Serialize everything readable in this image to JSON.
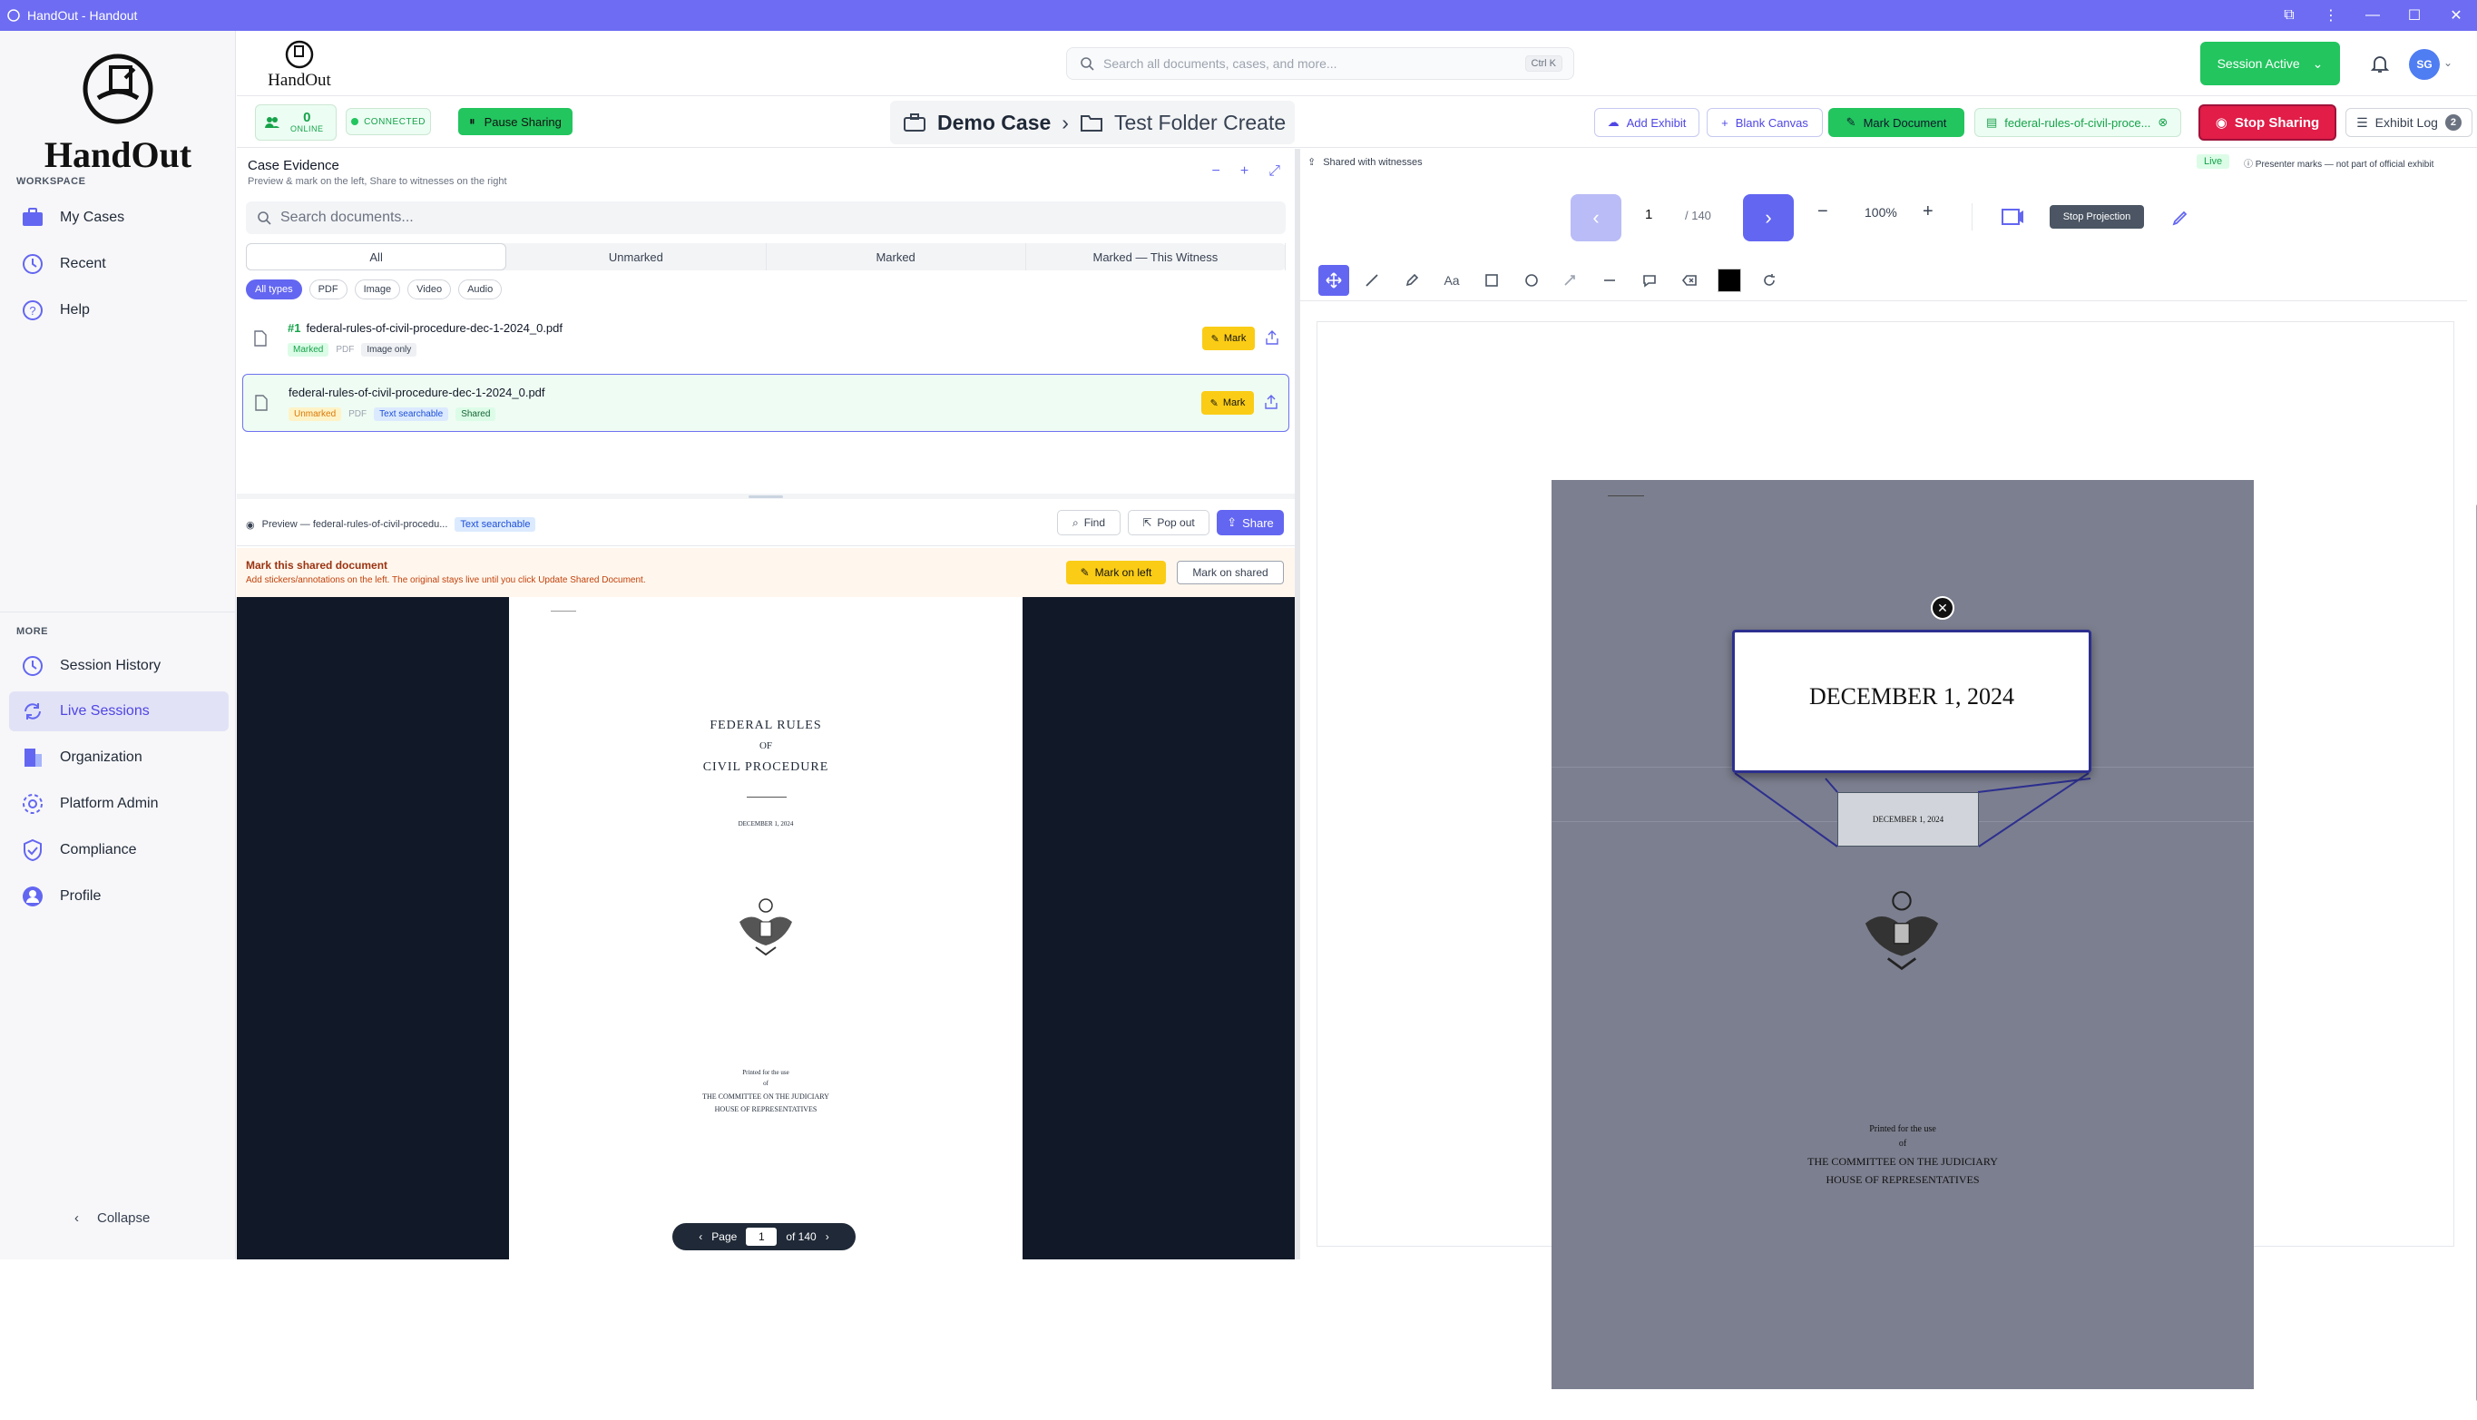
{
  "window": {
    "title": "HandOut - Handout"
  },
  "sidebar": {
    "workspace_label": "WORKSPACE",
    "more_label": "MORE",
    "items_workspace": [
      {
        "label": "My Cases",
        "icon": "briefcase-icon"
      },
      {
        "label": "Recent",
        "icon": "clock-icon"
      },
      {
        "label": "Help",
        "icon": "help-circle-icon"
      }
    ],
    "items_more": [
      {
        "label": "Session History",
        "icon": "clock-icon"
      },
      {
        "label": "Live Sessions",
        "icon": "refresh-icon",
        "active": true
      },
      {
        "label": "Organization",
        "icon": "building-icon"
      },
      {
        "label": "Platform Admin",
        "icon": "gear-icon"
      },
      {
        "label": "Compliance",
        "icon": "shield-check-icon"
      },
      {
        "label": "Profile",
        "icon": "user-icon"
      }
    ],
    "collapse_label": "Collapse",
    "logo_text": "HandOut"
  },
  "header": {
    "logo_text": "HandOut",
    "search_placeholder": "Search all documents, cases, and more...",
    "search_shortcut": "Ctrl K",
    "session_status": "Session Active",
    "avatar_initials": "SG"
  },
  "subbar": {
    "online_count": "0",
    "online_label": "ONLINE",
    "connection_status": "CONNECTED",
    "pause_label": "Pause Sharing",
    "breadcrumb_case": "Demo Case",
    "breadcrumb_folder": "Test Folder Create",
    "add_exhibit": "Add Exhibit",
    "blank_canvas": "Blank Canvas",
    "mark_document": "Mark Document",
    "exhibit_chip": "federal-rules-of-civil-proce...",
    "stop_sharing": "Stop Sharing",
    "exhibit_log": "Exhibit Log",
    "exhibit_log_count": "2"
  },
  "case_evidence": {
    "title": "Case Evidence",
    "subtitle": "Preview & mark on the left, Share to witnesses on the right",
    "search_placeholder": "Search documents...",
    "tabs": [
      "All",
      "Unmarked",
      "Marked",
      "Marked — This Witness"
    ],
    "filters": [
      "All types",
      "PDF",
      "Image",
      "Video",
      "Audio"
    ],
    "documents": [
      {
        "number": "#1",
        "name": "federal-rules-of-civil-procedure-dec-1-2024_0.pdf",
        "status": "Marked",
        "type": "PDF",
        "tag": "Image only",
        "mark": "Mark"
      },
      {
        "number": "",
        "name": "federal-rules-of-civil-procedure-dec-1-2024_0.pdf",
        "status": "Unmarked",
        "type": "PDF",
        "tag": "Text searchable",
        "tag2": "Shared",
        "mark": "Mark"
      }
    ]
  },
  "preview": {
    "title": "Preview — federal-rules-of-civil-procedu...",
    "badge": "Text searchable",
    "find": "Find",
    "pop_out": "Pop out",
    "share": "Share",
    "banner_title": "Mark this shared document",
    "banner_sub": "Add stickers/annotations on the left. The original stays live until you click Update Shared Document.",
    "mark_on_left": "Mark on left",
    "mark_on_shared": "Mark on shared",
    "page_title1": "FEDERAL RULES",
    "page_title2": "OF",
    "page_title3": "CIVIL PROCEDURE",
    "page_date": "DECEMBER 1, 2024",
    "printed1": "Printed for the use",
    "printed2": "of",
    "printed3": "THE COMMITTEE ON THE JUDICIARY",
    "printed4": "HOUSE OF REPRESENTATIVES",
    "pager_page": "Page",
    "pager_value": "1",
    "pager_of": "of 140"
  },
  "shared": {
    "label": "Shared with witnesses",
    "live": "Live",
    "note": "Presenter marks — not part of official exhibit",
    "page_value": "1",
    "page_total": "/ 140",
    "zoom": "100%",
    "stop_projection": "Stop Projection",
    "magnified_text": "DECEMBER 1, 2024",
    "small_text": "DECEMBER 1, 2024",
    "printed1": "Printed for the use",
    "printed2": "of",
    "printed3": "THE COMMITTEE ON THE JUDICIARY",
    "printed4": "HOUSE OF REPRESENTATIVES",
    "color_swatch": "#000000"
  },
  "colors": {
    "accent": "#6366f1",
    "green": "#22c55e",
    "red": "#e11d48",
    "titlebar": "#6d6cf2"
  }
}
